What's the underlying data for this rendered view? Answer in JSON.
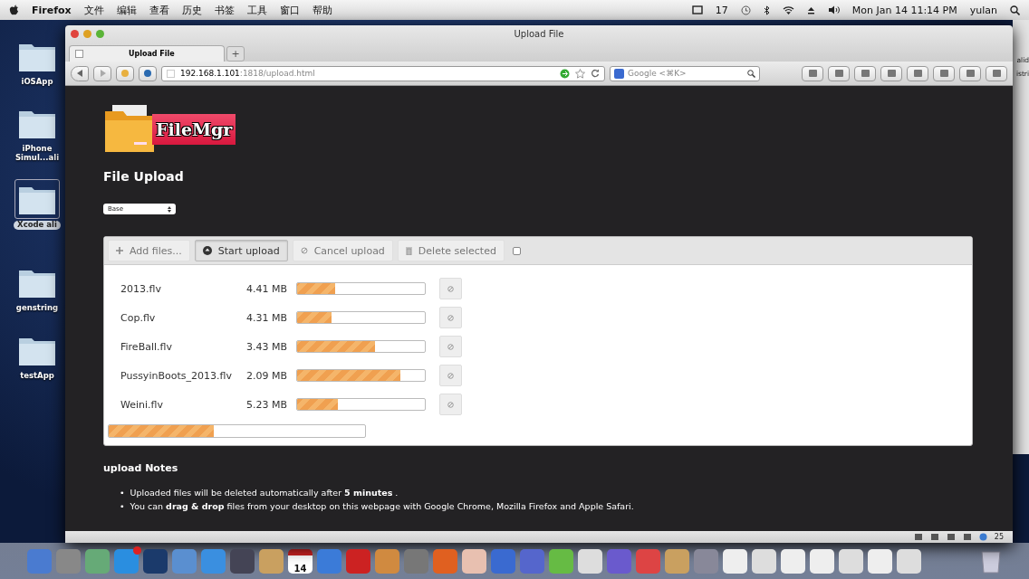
{
  "menu_bar": {
    "app_name": "Firefox",
    "menus": [
      "文件",
      "编辑",
      "查看",
      "历史",
      "书签",
      "工具",
      "窗口",
      "帮助"
    ],
    "status_number": "17",
    "clock": "Mon Jan 14  11:14 PM",
    "user": "yulan"
  },
  "desktop_icons": [
    {
      "label": "iOSApp",
      "selected": false
    },
    {
      "label": "iPhone\nSimul...ali",
      "selected": false
    },
    {
      "label": "Xcode ali",
      "selected": true
    },
    {
      "label": "genstring",
      "selected": false
    },
    {
      "label": "testApp",
      "selected": false
    }
  ],
  "background_window": {
    "texts": [
      "alid",
      "istri"
    ]
  },
  "window": {
    "title": "Upload File",
    "tab": {
      "label": "Upload File",
      "selected": true
    },
    "new_tab": "+",
    "url_host": "192.168.1.101",
    "url_rest": ":1818/upload.html",
    "search_placeholder": "Google <⌘K>"
  },
  "page": {
    "logo_text": "FileMgr",
    "heading": "File Upload",
    "select": {
      "value": "Base"
    },
    "toolbar": [
      {
        "label": "Add files...",
        "kind": "add",
        "selected": false
      },
      {
        "label": "Start upload",
        "kind": "start",
        "selected": true
      },
      {
        "label": "Cancel upload",
        "kind": "cancel",
        "selected": false
      },
      {
        "label": "Delete selected",
        "kind": "delete",
        "selected": false
      }
    ],
    "select_all": {
      "checked": false
    },
    "files": [
      {
        "name": "2013.flv",
        "size": "4.41 MB",
        "level": 0.3
      },
      {
        "name": "Cop.flv",
        "size": "4.31 MB",
        "level": 0.27
      },
      {
        "name": "FireBall.flv",
        "size": "3.43 MB",
        "level": 0.61
      },
      {
        "name": "PussyinBoots_2013.flv",
        "size": "2.09 MB",
        "level": 0.81
      },
      {
        "name": "Weini.flv",
        "size": "5.23 MB",
        "level": 0.32
      }
    ],
    "overall": {
      "level": 0.41
    },
    "notes": {
      "heading": "upload Notes",
      "bullet": "•",
      "items": [
        "Uploaded files will be deleted automatically after **5 minutes** .",
        "You can **drag & drop** files from your desktop on this webpage with Google Chrome, Mozilla Firefox and Apple Safari."
      ]
    }
  },
  "addon_bar": {
    "count": "25"
  },
  "dock": {
    "calendar_date": "14"
  }
}
